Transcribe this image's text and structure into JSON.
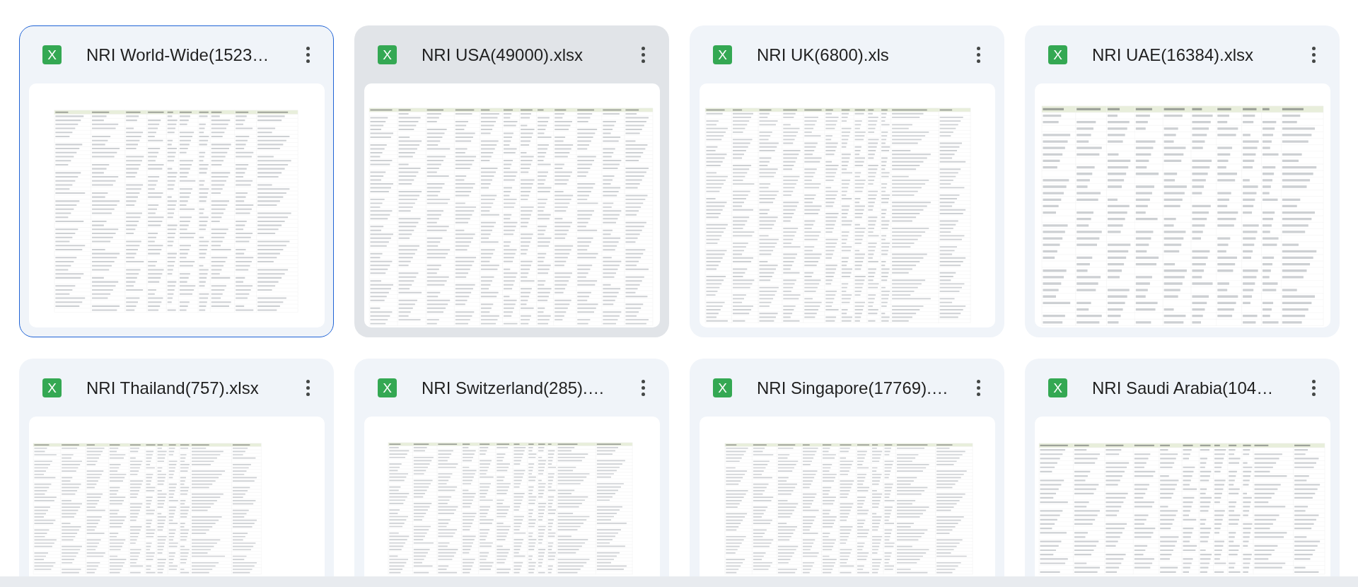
{
  "files": [
    {
      "name": "NRI World-Wide(1523…",
      "icon_text": "X",
      "selected": true,
      "hovered": false
    },
    {
      "name": "NRI USA(49000).xlsx",
      "icon_text": "X",
      "selected": false,
      "hovered": true
    },
    {
      "name": "NRI UK(6800).xls",
      "icon_text": "X",
      "selected": false,
      "hovered": false
    },
    {
      "name": "NRI UAE(16384).xlsx",
      "icon_text": "X",
      "selected": false,
      "hovered": false
    },
    {
      "name": "NRI Thailand(757).xlsx",
      "icon_text": "X",
      "selected": false,
      "hovered": false
    },
    {
      "name": "NRI Switzerland(285).…",
      "icon_text": "X",
      "selected": false,
      "hovered": false
    },
    {
      "name": "NRI Singapore(17769).…",
      "icon_text": "X",
      "selected": false,
      "hovered": false
    },
    {
      "name": "NRI Saudi Arabia(104…",
      "icon_text": "X",
      "selected": false,
      "hovered": false
    }
  ]
}
